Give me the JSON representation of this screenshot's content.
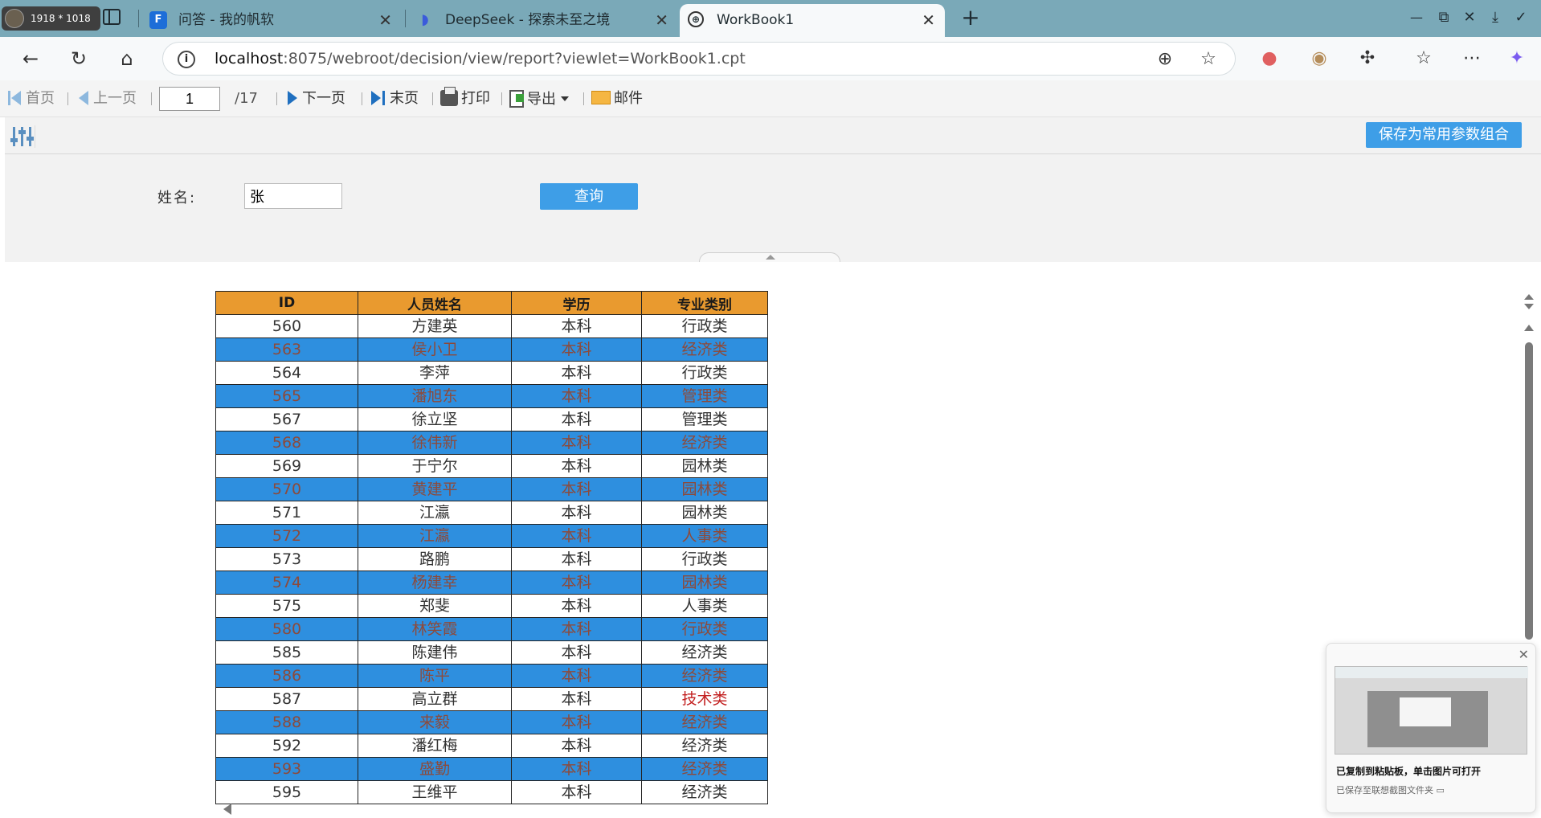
{
  "window": {
    "size_badge": "1918 * 1018",
    "tabs": [
      {
        "title": "问答 - 我的帆软",
        "favicon": "fanruan-icon"
      },
      {
        "title": "DeepSeek - 探索未至之境",
        "favicon": "deepseek-icon"
      },
      {
        "title": "WorkBook1",
        "favicon": "globe-icon",
        "active": true
      }
    ],
    "new_tab": "+"
  },
  "address_bar": {
    "host": "localhost",
    "rest": ":8075/webroot/decision/view/report?viewlet=WorkBook1.cpt"
  },
  "report_toolbar": {
    "first": "首页",
    "prev": "上一页",
    "page_current": "1",
    "page_total": "/17",
    "next": "下一页",
    "last": "末页",
    "print": "打印",
    "export": "导出",
    "mail": "邮件"
  },
  "parameter_panel": {
    "save_combo": "保存为常用参数组合",
    "name_label": "姓名:",
    "name_value": "张",
    "query": "查询"
  },
  "table": {
    "headers": [
      "ID",
      "人员姓名",
      "学历",
      "专业类别"
    ],
    "rows": [
      [
        "560",
        "方建英",
        "本科",
        "行政类"
      ],
      [
        "563",
        "侯小卫",
        "本科",
        "经济类"
      ],
      [
        "564",
        "李萍",
        "本科",
        "行政类"
      ],
      [
        "565",
        "潘旭东",
        "本科",
        "管理类"
      ],
      [
        "567",
        "徐立坚",
        "本科",
        "管理类"
      ],
      [
        "568",
        "徐伟新",
        "本科",
        "经济类"
      ],
      [
        "569",
        "于宁尔",
        "本科",
        "园林类"
      ],
      [
        "570",
        "黄建平",
        "本科",
        "园林类"
      ],
      [
        "571",
        "江瀛",
        "本科",
        "园林类"
      ],
      [
        "572",
        "江瀛",
        "本科",
        "人事类"
      ],
      [
        "573",
        "路鹏",
        "本科",
        "行政类"
      ],
      [
        "574",
        "杨建幸",
        "本科",
        "园林类"
      ],
      [
        "575",
        "郑斐",
        "本科",
        "人事类"
      ],
      [
        "580",
        "林笑霞",
        "本科",
        "行政类"
      ],
      [
        "585",
        "陈建伟",
        "本科",
        "经济类"
      ],
      [
        "586",
        "陈平",
        "本科",
        "经济类"
      ],
      [
        "587",
        "高立群",
        "本科",
        "技术类"
      ],
      [
        "588",
        "来毅",
        "本科",
        "经济类"
      ],
      [
        "592",
        "潘红梅",
        "本科",
        "经济类"
      ],
      [
        "593",
        "盛勤",
        "本科",
        "经济类"
      ],
      [
        "595",
        "王维平",
        "本科",
        "经济类"
      ]
    ],
    "highlight_row_index": 16,
    "colors": {
      "header": "#e99a2f",
      "band": "#2e8fdf",
      "highlight_text": "#c21f1f"
    }
  },
  "toast": {
    "title": "已复制到粘贴板，单击图片可打开",
    "subtitle": "已保存至联想截图文件夹"
  }
}
